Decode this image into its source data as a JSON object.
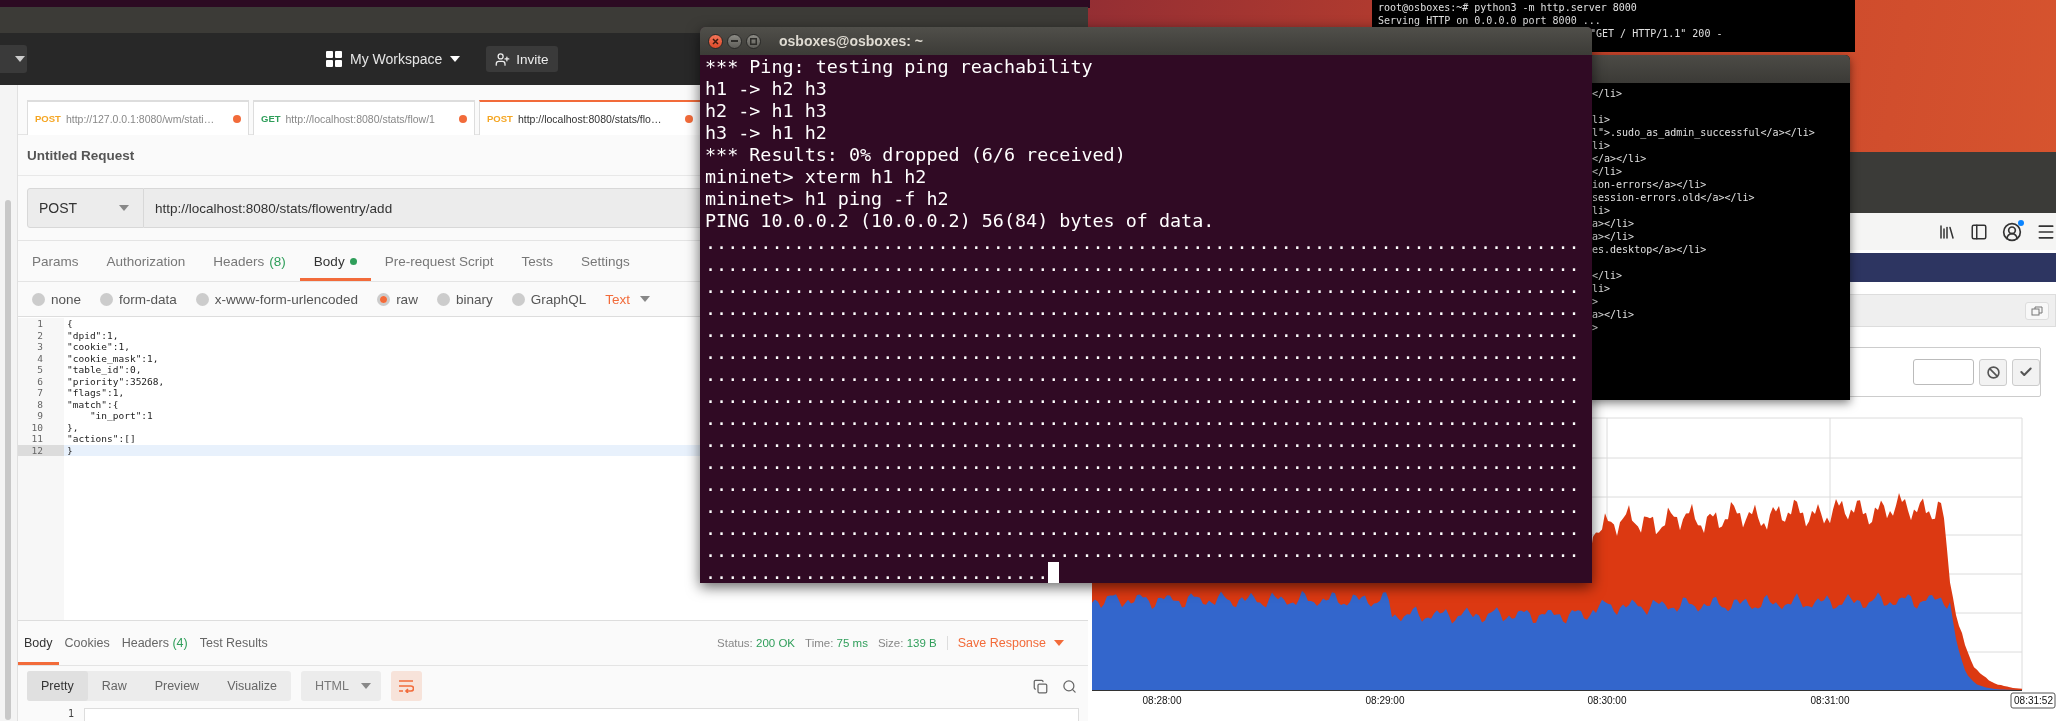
{
  "postman": {
    "workspace": "My Workspace",
    "invite": "Invite",
    "request_tabs": [
      {
        "method": "POST",
        "color": "#f5a623",
        "url": "http://127.0.0.1:8080/wm/stati…",
        "unsaved": true,
        "selected": false
      },
      {
        "method": "GET",
        "color": "#2f9e5a",
        "url": "http://localhost:8080/stats/flow/1",
        "unsaved": true,
        "selected": false
      },
      {
        "method": "POST",
        "color": "#f5a623",
        "url": "http://localhost:8080/stats/flo…",
        "unsaved": true,
        "selected": true
      }
    ],
    "request_title": "Untitled Request",
    "method": "POST",
    "url": "http://localhost:8080/stats/flowentry/add",
    "tabs": [
      {
        "label": "Params",
        "selected": false
      },
      {
        "label": "Authorization",
        "selected": false
      },
      {
        "label": "Headers",
        "count": "(8)",
        "selected": false
      },
      {
        "label": "Body",
        "has_content": true,
        "selected": true
      },
      {
        "label": "Pre-request Script",
        "selected": false
      },
      {
        "label": "Tests",
        "selected": false
      },
      {
        "label": "Settings",
        "selected": false
      }
    ],
    "body_types": [
      {
        "label": "none",
        "selected": false
      },
      {
        "label": "form-data",
        "selected": false
      },
      {
        "label": "x-www-form-urlencoded",
        "selected": false
      },
      {
        "label": "raw",
        "selected": true
      },
      {
        "label": "binary",
        "selected": false
      },
      {
        "label": "GraphQL",
        "selected": false
      }
    ],
    "body_format": "Text",
    "code_lines": [
      {
        "number": "1",
        "text": "{",
        "current": false
      },
      {
        "number": "2",
        "text": "\"dpid\":1,",
        "current": false
      },
      {
        "number": "3",
        "text": "\"cookie\":1,",
        "current": false
      },
      {
        "number": "4",
        "text": "\"cookie_mask\":1,",
        "current": false
      },
      {
        "number": "5",
        "text": "\"table_id\":0,",
        "current": false
      },
      {
        "number": "6",
        "text": "\"priority\":35268,",
        "current": false
      },
      {
        "number": "7",
        "text": "\"flags\":1,",
        "current": false
      },
      {
        "number": "8",
        "text": "\"match\":{",
        "current": false
      },
      {
        "number": "9",
        "text": "    \"in_port\":1",
        "current": false
      },
      {
        "number": "10",
        "text": "},",
        "current": false
      },
      {
        "number": "11",
        "text": "\"actions\":[]",
        "current": false
      },
      {
        "number": "12",
        "text": "}",
        "current": true
      }
    ],
    "response": {
      "tabs": [
        {
          "label": "Body",
          "selected": true
        },
        {
          "label": "Cookies",
          "selected": false
        },
        {
          "label": "Headers",
          "count": "(4)",
          "selected": false
        },
        {
          "label": "Test Results",
          "selected": false
        }
      ],
      "status_label": "Status:",
      "status": "200 OK",
      "time_label": "Time:",
      "time": "75 ms",
      "size_label": "Size:",
      "size": "139 B",
      "save": "Save Response",
      "view_modes": [
        {
          "label": "Pretty",
          "selected": true
        },
        {
          "label": "Raw",
          "selected": false
        },
        {
          "label": "Preview",
          "selected": false
        },
        {
          "label": "Visualize",
          "selected": false
        }
      ],
      "format": "HTML",
      "first_line_number": "1"
    }
  },
  "terminal": {
    "title": "osboxes@osboxes: ~",
    "lines": [
      "*** Ping: testing ping reachability",
      "h1 -> h2 h3",
      "h2 -> h1 h3",
      "h3 -> h1 h2",
      "*** Results: 0% dropped (6/6 received)",
      "mininet> xterm h1 h2",
      "mininet> h1 ping -f h2",
      "PING 10.0.0.2 (10.0.0.2) 56(84) bytes of data.",
      "...............................................................................",
      "...............................................................................",
      "...............................................................................",
      "...............................................................................",
      "...............................................................................",
      "...............................................................................",
      "...............................................................................",
      "...............................................................................",
      "...............................................................................",
      "...............................................................................",
      "...............................................................................",
      "...............................................................................",
      "...............................................................................",
      "...............................................................................",
      "...............................................................................",
      "..............................."
    ]
  },
  "server_terminal": {
    "lines": [
      "root@osboxes:~# python3 -m http.server 8000",
      "Serving HTTP on 0.0.0.0 port 8000 ...",
      "\"GET / HTTP/1.1\" 200 -"
    ]
  },
  "xterm": {
    "lines": [
      {
        "text": "</li>",
        "space_before": false
      },
      {
        "text": "li>",
        "space_before": true
      },
      {
        "text": "l\">.sudo_as_admin_successful</a></li>",
        "space_before": false
      },
      {
        "text": "li>",
        "space_before": false
      },
      {
        "text": "</a></li>",
        "space_before": false
      },
      {
        "text": "</li>",
        "space_before": false
      },
      {
        "text": "ion-errors</a></li>",
        "space_before": false
      },
      {
        "text": "session-errors.old</a></li>",
        "space_before": false
      },
      {
        "text": "li>",
        "space_before": false
      },
      {
        "text": "a></li>",
        "space_before": false
      },
      {
        "text": "a></li>",
        "space_before": false
      },
      {
        "text": "es.desktop</a></li>",
        "space_before": false
      },
      {
        "text": "</li>",
        "space_before": true
      },
      {
        "text": "li>",
        "space_before": false
      },
      {
        "text": ">",
        "space_before": false
      },
      {
        "text": "a></li>",
        "space_before": false
      },
      {
        "text": ">",
        "space_before": false
      }
    ]
  },
  "browser": {
    "chart": {
      "x_labels": [
        "08:28:00",
        "08:29:00",
        "08:30:00",
        "08:31:00",
        "08:31:52"
      ]
    }
  }
}
